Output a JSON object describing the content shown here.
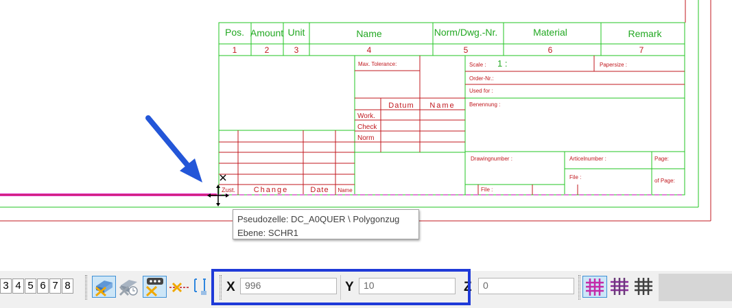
{
  "title_block": {
    "headers": {
      "pos": "Pos.",
      "amount": "Amount",
      "unit": "Unit",
      "name": "Name",
      "norm": "Norm/Dwg.-Nr.",
      "material": "Material",
      "remark": "Remark"
    },
    "numbers": {
      "n1": "1",
      "n2": "2",
      "n3": "3",
      "n4": "4",
      "n5": "5",
      "n6": "6",
      "n7": "7"
    },
    "max_tolerance": "Max. Tolerance:",
    "scale_label": "Scale :",
    "scale_value": "1 :",
    "papersize": "Papersize :",
    "order_nr": "Order-Nr.:",
    "used_for": "Used for :",
    "benennung": "Benennung :",
    "datum": "Datum",
    "name_col": "Name",
    "work": "Work.",
    "check": "Check",
    "norm": "Norm",
    "drawingnumber": "Drawingnumber :",
    "articelnumber": "Articelnumber :",
    "page": "Page:",
    "of_page": "of Page:",
    "file1": "File :",
    "file2": "File :",
    "zust": "Zust.",
    "change": "Change",
    "date": "Date",
    "name_small": "Name"
  },
  "tooltip": {
    "line1": "Pseudozelle: DC_A0QUER \\ Polygonzug",
    "line2": "Ebene: SCHR1"
  },
  "toolbar": {
    "view_numbers": [
      "3",
      "4",
      "5",
      "6",
      "7",
      "8"
    ],
    "x_label": "X",
    "x_value": "996",
    "y_label": "Y",
    "y_value": "10",
    "z_label": "Z",
    "z_value": "0"
  },
  "colors": {
    "frame_red": "#c0171d",
    "grid_green": "#22c522",
    "selection_magenta": "#e030c8",
    "highlight_blue": "#1f3ad8",
    "arrow_blue": "#2356d8"
  }
}
